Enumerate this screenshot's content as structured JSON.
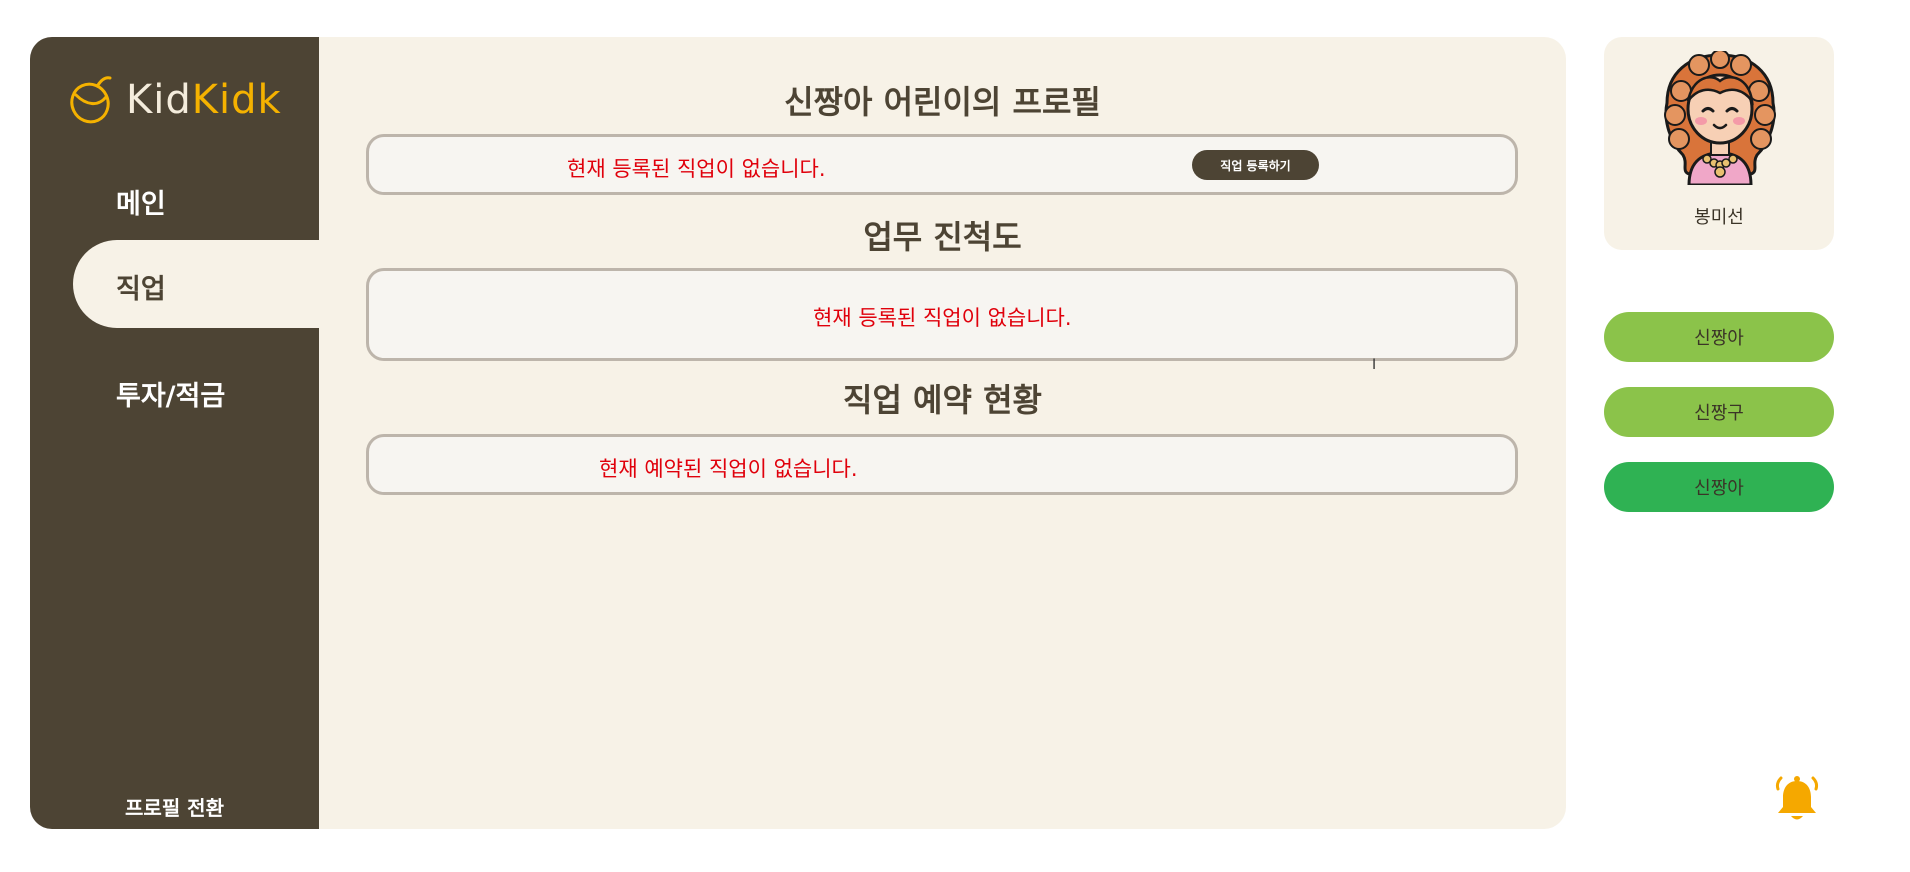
{
  "brand": {
    "logo_part1": "Kid",
    "logo_part2": "Kidk",
    "accent": "#f5b200"
  },
  "sidebar": {
    "items": [
      {
        "label": "메인"
      },
      {
        "label": "직업",
        "active": true
      },
      {
        "label": "투자/적금"
      }
    ],
    "profile_switch": "프로필 전환",
    "bg_color": "#4d4434"
  },
  "main": {
    "profile_title": "신짱아 어린이의 프로필",
    "job_status_message": "현재 등록된 직업이 없습니다.",
    "register_job_button": "직업 등록하기",
    "progress_title": "업무 진척도",
    "progress_message": "현재 등록된 직업이 없습니다.",
    "reservation_title": "직업 예약 현황",
    "reservation_message": "현재 예약된 직업이 없습니다.",
    "message_color": "#e0000b"
  },
  "profile": {
    "name": "봉미선",
    "avatar_icon": "girl-avatar-icon"
  },
  "children": [
    {
      "name": "신짱아",
      "color": "#8bc34a"
    },
    {
      "name": "신짱구",
      "color": "#8bc34a"
    },
    {
      "name": "신짱아",
      "color": "#2fb253"
    }
  ],
  "notifications": {
    "icon": "bell-icon",
    "color": "#f5a800"
  }
}
